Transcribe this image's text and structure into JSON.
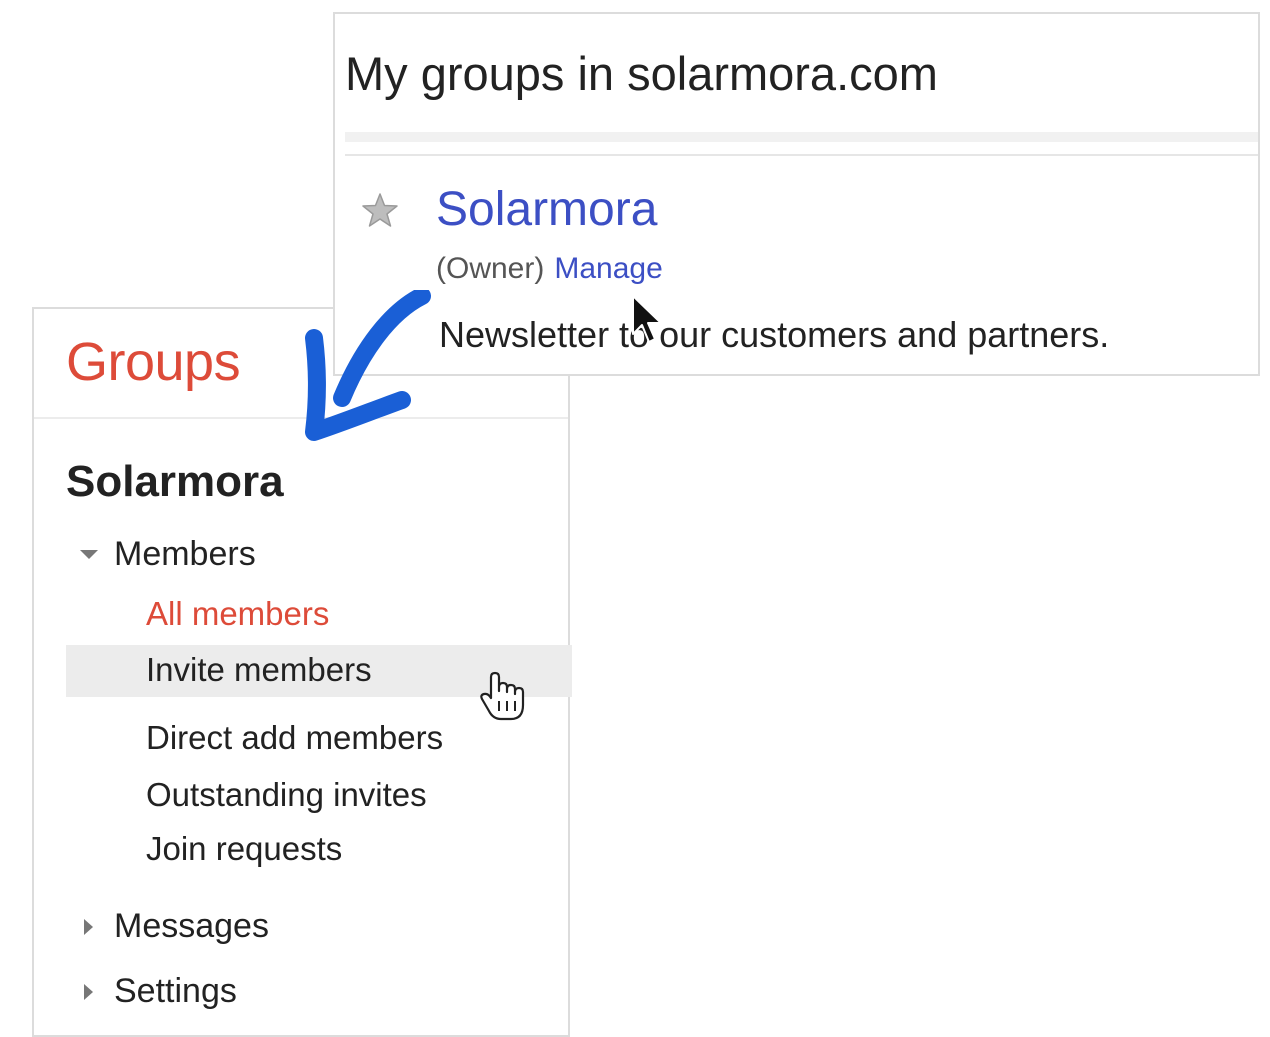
{
  "groups_list": {
    "title": "My groups in solarmora.com",
    "group": {
      "name": "Solarmora",
      "role": "(Owner)",
      "manage_label": "Manage",
      "description": "Newsletter to our customers and partners."
    }
  },
  "sidebar": {
    "app_title": "Groups",
    "group_name": "Solarmora",
    "sections": {
      "members": {
        "label": "Members",
        "items": [
          "All members",
          "Invite members",
          "Direct add members",
          "Outstanding invites",
          "Join requests"
        ]
      },
      "messages": {
        "label": "Messages"
      },
      "settings": {
        "label": "Settings"
      }
    }
  },
  "colors": {
    "brand_red": "#dd4b39",
    "link_blue": "#3c4fc4",
    "annotation_blue": "#1a5fd6",
    "hover_gray": "#ececec"
  },
  "icons": [
    "star-icon",
    "arrow-cursor-icon",
    "hand-cursor-icon",
    "chevron-down-icon",
    "chevron-right-icon",
    "annotation-arrow"
  ]
}
